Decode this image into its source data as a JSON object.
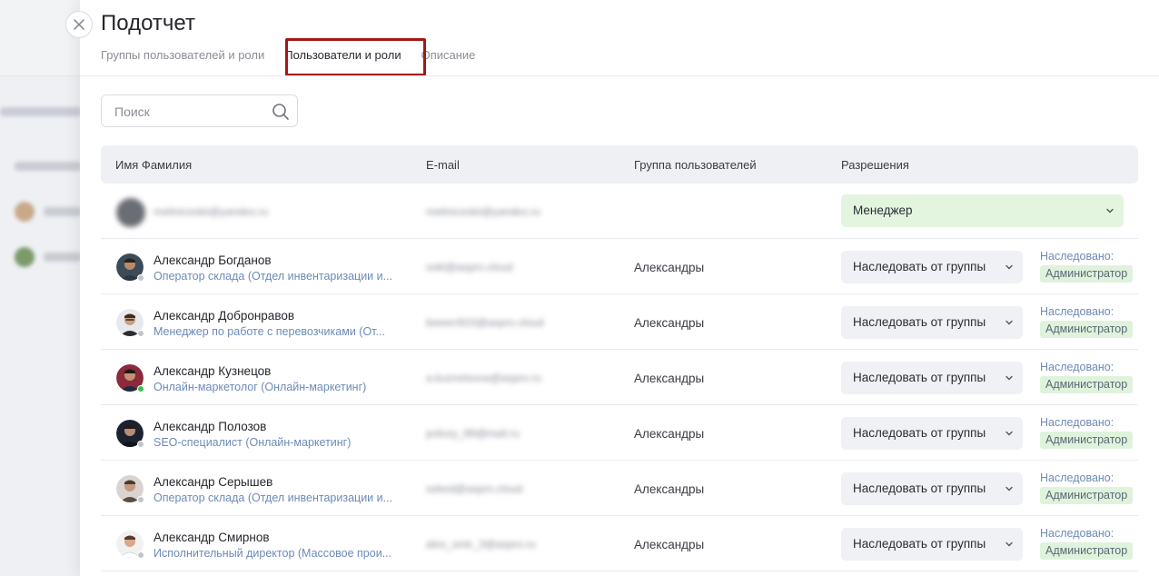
{
  "panel": {
    "title": "Подотчет"
  },
  "tabs": [
    {
      "label": "Группы пользователей и роли",
      "active": false
    },
    {
      "label": "Пользователи и роли",
      "active": true
    },
    {
      "label": "Описание",
      "active": false
    }
  ],
  "search": {
    "placeholder": "Поиск",
    "value": ""
  },
  "table": {
    "headers": {
      "name": "Имя Фамилия",
      "email": "E-mail",
      "group": "Группа пользователей",
      "permissions": "Разрешения"
    },
    "current_user": {
      "name": "meliniceskii@yandex.ru",
      "email": "meliniceskii@yandex.ru",
      "permission": "Менеджер"
    },
    "rows": [
      {
        "name": "Александр Богданов",
        "role": "Оператор склада (Отдел инвентаризации и...",
        "email": "sokl@aspro.cloud",
        "group": "Александры",
        "permission": "Наследовать от группы",
        "inherit_caption": "Наследовано:",
        "inherit_role": "Администратор",
        "status": "offline"
      },
      {
        "name": "Александр Добронравов",
        "role": "Менеджер по работе с перевозчиками (От...",
        "email": "bween910@aspro.cloud",
        "group": "Александры",
        "permission": "Наследовать от группы",
        "inherit_caption": "Наследовано:",
        "inherit_role": "Администратор",
        "status": "offline"
      },
      {
        "name": "Александр Кузнецов",
        "role": "Онлайн-маркетолог (Онлайн-маркетинг)",
        "email": "a.kuznetsova@aspro.ru",
        "group": "Александры",
        "permission": "Наследовать от группы",
        "inherit_caption": "Наследовано:",
        "inherit_role": "Администратор",
        "status": "online"
      },
      {
        "name": "Александр Полозов",
        "role": "SEO-специалист (Онлайн-маркетинг)",
        "email": "polozy_89@mail.ru",
        "group": "Александры",
        "permission": "Наследовать от группы",
        "inherit_caption": "Наследовано:",
        "inherit_role": "Администратор",
        "status": "offline"
      },
      {
        "name": "Александр Серышев",
        "role": "Оператор склада (Отдел инвентаризации и...",
        "email": "seked@aspro.cloud",
        "group": "Александры",
        "permission": "Наследовать от группы",
        "inherit_caption": "Наследовано:",
        "inherit_role": "Администратор",
        "status": "offline"
      },
      {
        "name": "Александр Смирнов",
        "role": "Исполнительный директор (Массовое прои...",
        "email": "alex_smir_3@aspro.ru",
        "group": "Александры",
        "permission": "Наследовать от группы",
        "inherit_caption": "Наследовано:",
        "inherit_role": "Администратор",
        "status": "offline"
      }
    ]
  },
  "icons": {
    "close": "close-icon",
    "search": "search-icon",
    "chevron": "chevron-down-icon"
  },
  "colors": {
    "highlight_border": "#a31818",
    "online": "#3cc04b",
    "offline": "#c2c5cc",
    "inherit_badge_bg": "#dff3dc",
    "manager_select_bg": "#e3f5df",
    "role_text": "#6d8ab8"
  }
}
